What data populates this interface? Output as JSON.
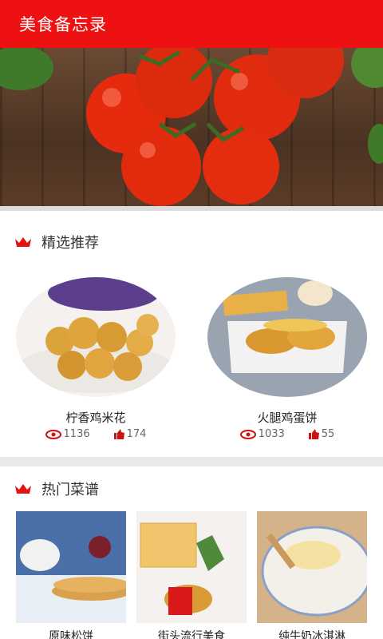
{
  "app": {
    "title": "美食备忘录"
  },
  "hero": {
    "image": "tomatoes-on-wood-banner"
  },
  "featured": {
    "title": "精选推荐",
    "icon": "crown-icon",
    "items": [
      {
        "name": "柠香鸡米花",
        "views": "1136",
        "likes": "174"
      },
      {
        "name": "火腿鸡蛋饼",
        "views": "1033",
        "likes": "55"
      }
    ]
  },
  "hot": {
    "title": "热门菜谱",
    "icon": "crown-icon",
    "items": [
      {
        "name": "原味松饼"
      },
      {
        "name": "街头流行美食"
      },
      {
        "name": "纯牛奶冰淇淋"
      }
    ]
  },
  "colors": {
    "accent": "#ee1111",
    "text": "#333333",
    "muted": "#666666"
  }
}
